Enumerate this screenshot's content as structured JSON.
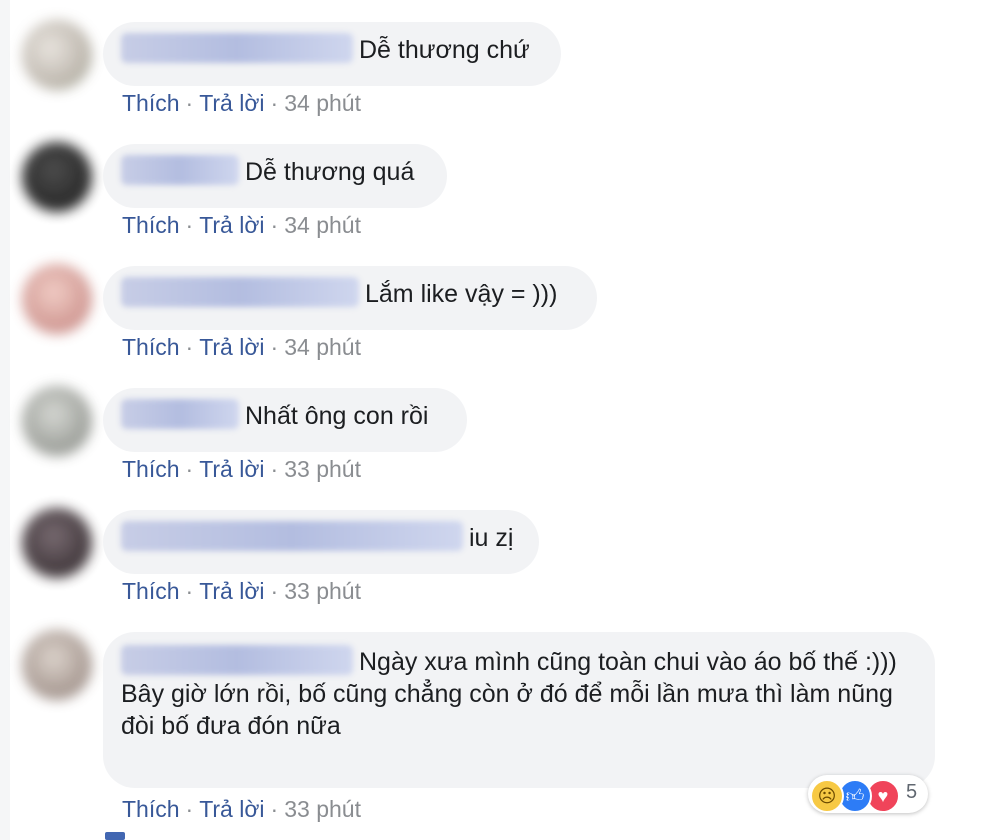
{
  "comments": [
    {
      "text": "Dễ thương chứ",
      "like": "Thích",
      "reply": "Trả lời",
      "dot": "·",
      "time": "34 phút",
      "avatar_color": "#c9c2b8"
    },
    {
      "text": "Dễ thương quá",
      "like": "Thích",
      "reply": "Trả lời",
      "dot": "·",
      "time": "34 phút",
      "avatar_color": "#1e1e1e"
    },
    {
      "text": "Lắm like vậy = )))",
      "like": "Thích",
      "reply": "Trả lời",
      "dot": "·",
      "time": "34 phút",
      "avatar_color": "#d8a6a0"
    },
    {
      "text": "Nhất ông con rồi",
      "like": "Thích",
      "reply": "Trả lời",
      "dot": "·",
      "time": "33 phút",
      "avatar_color": "#aeb0ab"
    },
    {
      "text": "iu zị",
      "like": "Thích",
      "reply": "Trả lời",
      "dot": "·",
      "time": "33 phút",
      "avatar_color": "#3b3036"
    },
    {
      "text": "Ngày xưa mình cũng toàn chui vào áo bố thế :)))",
      "text2": "Bây giờ lớn rồi, bố cũng chẳng còn ở đó để mỗi lần mưa thì làm nũng đòi bố đưa đón nữa",
      "like": "Thích",
      "reply": "Trả lời",
      "dot": "·",
      "time": "33 phút",
      "avatar_color": "#b9aaa1"
    }
  ],
  "reactions": {
    "count": "5",
    "icons": [
      "sad-icon",
      "like-icon",
      "love-icon"
    ]
  }
}
